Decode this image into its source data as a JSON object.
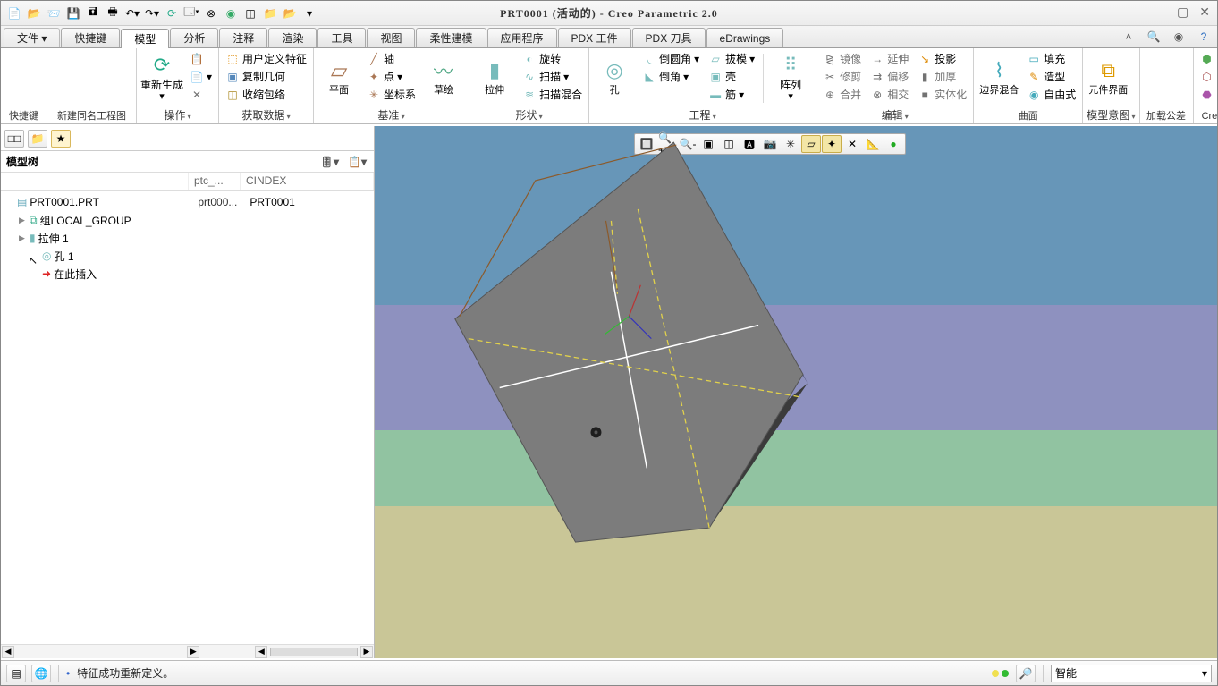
{
  "title": "PRT0001 (活动的) - Creo Parametric 2.0",
  "tabs": [
    "文件",
    "快捷键",
    "模型",
    "分析",
    "注释",
    "渲染",
    "工具",
    "视图",
    "柔性建模",
    "应用程序",
    "PDX 工件",
    "PDX 刀具",
    "eDrawings"
  ],
  "active_tab": 2,
  "ribbon": {
    "g1": {
      "label": "快捷键"
    },
    "g2": {
      "label": "新建同名工程图"
    },
    "g3": {
      "label": "操作",
      "regen": "重新生成",
      "items": [
        "",
        "",
        ""
      ]
    },
    "g4": {
      "label": "获取数据",
      "a": "用户定义特征",
      "b": "复制几何",
      "c": "收缩包络"
    },
    "g5": {
      "label": "基准",
      "plane": "平面",
      "axis": "轴",
      "point": "点",
      "csys": "坐标系",
      "sketch": "草绘"
    },
    "g6": {
      "label": "形状",
      "extrude": "拉伸",
      "rev": "旋转",
      "sweep": "扫描",
      "blend": "扫描混合"
    },
    "g7": {
      "label": "工程",
      "hole": "孔",
      "round": "倒圆角",
      "chamfer": "倒角",
      "draft": "拔模",
      "shell": "壳",
      "rib": "筋",
      "pattern": "阵列"
    },
    "g8": {
      "label": "编辑",
      "mirror": "镜像",
      "trim": "修剪",
      "merge": "合并",
      "extend": "延伸",
      "offset": "偏移",
      "intersect": "相交",
      "project": "投影",
      "thicken": "加厚",
      "solidify": "实体化"
    },
    "g9": {
      "label": "曲面",
      "bnd": "边界混合",
      "fill": "填充",
      "style": "造型",
      "free": "自由式"
    },
    "g10": {
      "label": "模型意图",
      "ui": "元件界面"
    },
    "g11": {
      "label": "加载公差"
    },
    "g12": {
      "label": "Creo中文插件"
    }
  },
  "tree": {
    "title": "模型树",
    "cols": [
      "",
      "ptc_...",
      "CINDEX"
    ],
    "rows": [
      {
        "lvl": 1,
        "exp": "",
        "icon": "📄",
        "t": "PRT0001.PRT",
        "c2": "prt000...",
        "c3": "PRT0001"
      },
      {
        "lvl": 2,
        "exp": "▶",
        "icon": "🔗",
        "t": "组LOCAL_GROUP",
        "c2": "",
        "c3": ""
      },
      {
        "lvl": 2,
        "exp": "▶",
        "icon": "⬚",
        "t": "拉伸 1",
        "c2": "",
        "c3": ""
      },
      {
        "lvl": 3,
        "exp": "",
        "icon": "◎",
        "t": "孔 1",
        "c2": "",
        "c3": ""
      },
      {
        "lvl": 3,
        "exp": "",
        "icon": "➜",
        "t": "在此插入",
        "c2": "",
        "c3": ""
      }
    ]
  },
  "status": {
    "msg": "特征成功重新定义。",
    "filter": "智能"
  }
}
